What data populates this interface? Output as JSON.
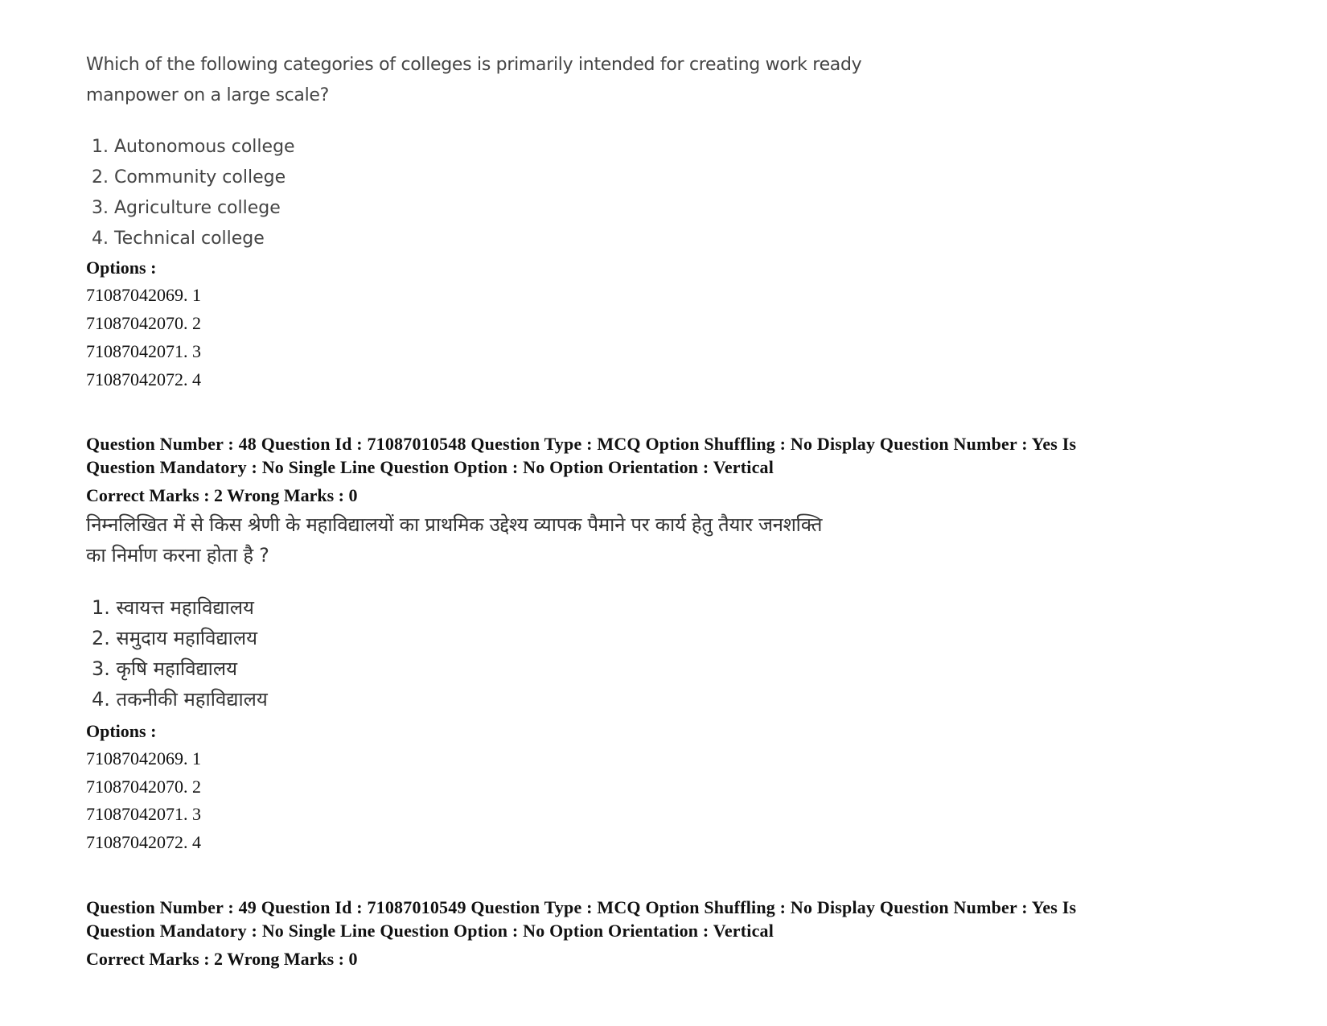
{
  "block1": {
    "question_lines": [
      "Which of the following categories of colleges is primarily intended for creating work ready",
      "manpower on a large scale?"
    ],
    "choices": [
      "1. Autonomous college",
      "2. Community college",
      "3. Agriculture college",
      "4. Technical college"
    ],
    "options_label": "Options :",
    "options": [
      "71087042069. 1",
      "71087042070. 2",
      "71087042071. 3",
      "71087042072. 4"
    ]
  },
  "block2": {
    "meta_lines": [
      "Question Number : 48 Question Id : 71087010548 Question Type : MCQ Option Shuffling : No Display Question Number : Yes Is",
      "Question Mandatory : No Single Line Question Option : No Option Orientation : Vertical"
    ],
    "marks": "Correct Marks : 2 Wrong Marks : 0",
    "question_lines": [
      "निम्नलिखित में से किस श्रेणी के महाविद्यालयों का प्राथमिक उद्देश्य व्यापक पैमाने पर कार्य हेतु तैयार जनशक्ति",
      "का निर्माण करना होता है ?"
    ],
    "choices": [
      "1. स्वायत्त महाविद्यालय",
      "2. समुदाय महाविद्यालय",
      "3. कृषि महाविद्यालय",
      "4. तकनीकी महाविद्यालय"
    ],
    "options_label": "Options :",
    "options": [
      "71087042069. 1",
      "71087042070. 2",
      "71087042071. 3",
      "71087042072. 4"
    ]
  },
  "block3": {
    "meta_lines": [
      "Question Number : 49 Question Id : 71087010549 Question Type : MCQ Option Shuffling : No Display Question Number : Yes Is",
      "Question Mandatory : No Single Line Question Option : No Option Orientation : Vertical"
    ],
    "marks": "Correct Marks : 2 Wrong Marks : 0"
  }
}
